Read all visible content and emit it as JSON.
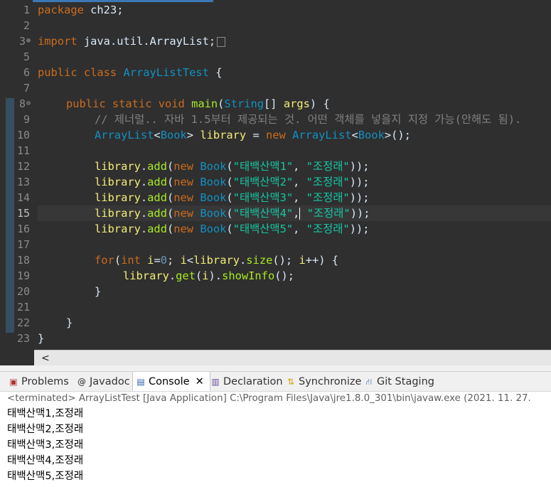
{
  "editor": {
    "line_numbers": [
      "1",
      "2",
      "3",
      "5",
      "6",
      "7",
      "8",
      "9",
      "10",
      "11",
      "12",
      "13",
      "14",
      "15",
      "16",
      "17",
      "18",
      "19",
      "20",
      "21",
      "22",
      "23"
    ],
    "code": {
      "l1_kw": "package",
      "l1_rest": " ch23;",
      "l3_kw": "import",
      "l3_rest": " java.util.ArrayList;",
      "l6_kw": "public class",
      "l6_name": " ArrayListTest",
      "l6_rest": " {",
      "l8_kw": "public static void",
      "l8_fn": " main",
      "l8_p1": "(",
      "l8_ty": "String",
      "l8_p2": "[] ",
      "l8_var": "args",
      "l8_p3": ") {",
      "l9_comment": "// 제너럴.. 자바 1.5부터 제공되는 것. 어떤 객체를 넣을지 지정 가능(안해도 됨).",
      "l10_ty1": "ArrayList",
      "l10_lt1": "<",
      "l10_ty2": "Book",
      "l10_gt1": ">",
      "l10_var": " library",
      "l10_eq": " = ",
      "l10_new": "new",
      "l10_ty3": " ArrayList",
      "l10_lt2": "<",
      "l10_ty4": "Book",
      "l10_end": ">();",
      "add_var": "library",
      "add_dot": ".",
      "add_fn": "add",
      "add_open": "(",
      "add_new": "new",
      "add_ty": " Book",
      "add_open2": "(",
      "add_comma": ", ",
      "add_close": "));",
      "books": [
        "\"태백산맥1\"",
        "\"태백산맥2\"",
        "\"태백산맥3\"",
        "\"태백산맥4\"",
        "\"태백산맥5\""
      ],
      "author": "\"조정래\"",
      "l18_for": "for",
      "l18_p1": "(",
      "l18_int": "int",
      "l18_i": " i",
      "l18_eq": "=",
      "l18_zero": "0",
      "l18_semi": "; ",
      "l18_i2": "i",
      "l18_lt": "<",
      "l18_lib": "library",
      "l18_dot": ".",
      "l18_size": "size",
      "l18_rest": "(); ",
      "l18_i3": "i",
      "l18_end": "++) {",
      "l19_lib": "library",
      "l19_dot": ".",
      "l19_get": "get",
      "l19_p1": "(",
      "l19_i": "i",
      "l19_p2": ").",
      "l19_show": "showInfo",
      "l19_end": "();",
      "brace_close": "}",
      "brace_open": "{"
    },
    "hscroll_arrow": "<"
  },
  "panel": {
    "tabs": [
      {
        "label": "Problems",
        "icon": "problems-icon"
      },
      {
        "label": "Javadoc",
        "icon": "javadoc-icon"
      },
      {
        "label": "Console",
        "icon": "console-icon"
      },
      {
        "label": "Declaration",
        "icon": "declaration-icon"
      },
      {
        "label": "Synchronize",
        "icon": "synchronize-icon"
      },
      {
        "label": "Git Staging",
        "icon": "git-staging-icon"
      }
    ],
    "active_tab": "Console",
    "close_glyph": "✕"
  },
  "console": {
    "status": "<terminated> ArrayListTest [Java Application] C:\\Program Files\\Java\\jre1.8.0_301\\bin\\javaw.exe  (2021. 11. 27.",
    "output": [
      "태백산맥1,조정래",
      "태백산맥2,조정래",
      "태백산맥3,조정래",
      "태백산맥4,조정래",
      "태백산맥5,조정래"
    ]
  },
  "colors": {
    "editor_bg": "#2f2f2f",
    "keyword": "#cc6c1d",
    "type": "#1290c3",
    "method": "#a7ec21",
    "string": "#17c6a3",
    "comment": "#808080",
    "variable": "#f3ec79"
  }
}
